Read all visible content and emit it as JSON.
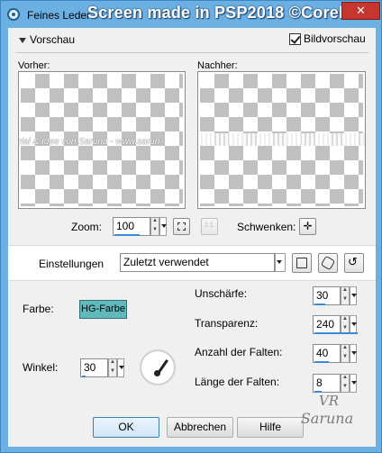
{
  "window": {
    "title": "Feines Leder",
    "watermark": "Screen made in PSP2018 ©Corel",
    "close_symbol": "✕"
  },
  "preview": {
    "toggle_label": "Vorschau",
    "show_preview_label": "Bildvorschau",
    "before_label": "Vorher:",
    "after_label": "Nachher:",
    "before_overlay_text": "erial & Idee von Saruna - www.sarun"
  },
  "zoom": {
    "label": "Zoom:",
    "value": "100",
    "pan_label": "Schwenken:"
  },
  "settings": {
    "label": "Einstellungen",
    "preset": "Zuletzt verwendet"
  },
  "params": {
    "color_label": "Farbe:",
    "color_value": "HG-Farbe",
    "color_hex": "#62b9bd",
    "angle_label": "Winkel:",
    "angle_value": "30",
    "blur_label": "Unschärfe:",
    "blur_value": "30",
    "transparency_label": "Transparenz:",
    "transparency_value": "240",
    "folds_count_label": "Anzahl der Falten:",
    "folds_count_value": "40",
    "folds_length_label": "Länge der Falten:",
    "folds_length_value": "8"
  },
  "buttons": {
    "ok": "OK",
    "cancel": "Abbrechen",
    "help": "Hilfe"
  },
  "signature": {
    "initials": "VR",
    "name": "Saruna"
  },
  "colors": {
    "titlebar": "#6cb0e3",
    "close": "#c7352f",
    "accent": "#3c8ad6"
  }
}
